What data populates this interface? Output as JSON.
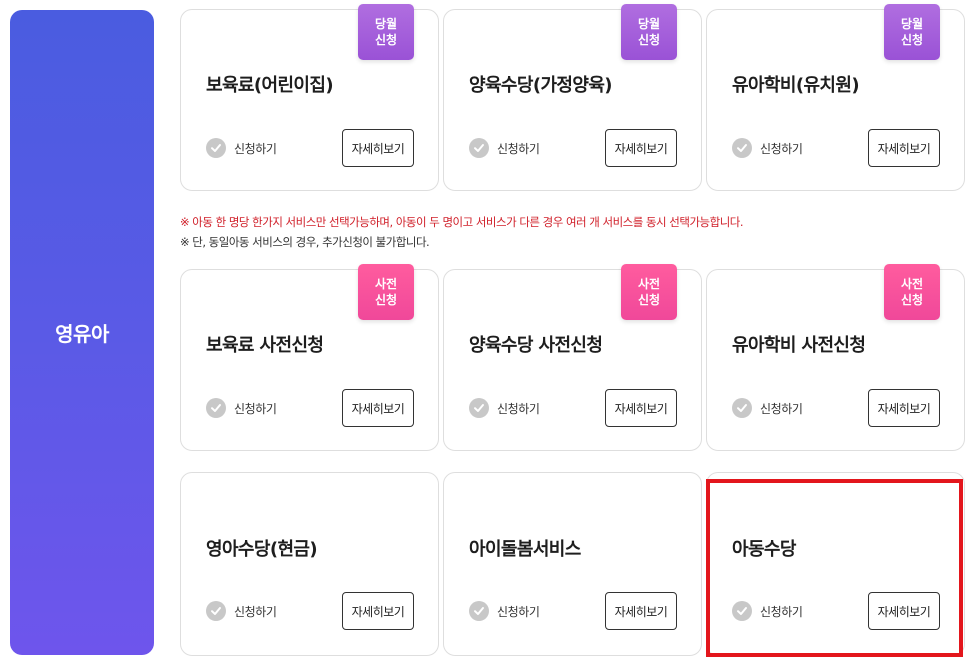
{
  "sidebar": {
    "label": "영유아"
  },
  "common": {
    "apply_label": "신청하기",
    "detail_label": "자세히보기"
  },
  "badges": {
    "monthly": {
      "line1": "당월",
      "line2": "신청"
    },
    "pre": {
      "line1": "사전",
      "line2": "신청"
    }
  },
  "row1": [
    {
      "title": "보육료(어린이집)"
    },
    {
      "title": "양육수당(가정양육)"
    },
    {
      "title": "유아학비(유치원)"
    }
  ],
  "notices": {
    "line1": "※ 아동 한 명당 한가지 서비스만 선택가능하며, 아동이 두 명이고 서비스가 다른 경우 여러 개 서비스를 동시 선택가능합니다.",
    "line2": "※ 단, 동일아동 서비스의 경우, 추가신청이 불가합니다."
  },
  "row2": [
    {
      "title": "보육료 사전신청"
    },
    {
      "title": "양육수당 사전신청"
    },
    {
      "title": "유아학비 사전신청"
    }
  ],
  "row3": [
    {
      "title": "영아수당(현금)"
    },
    {
      "title": "아이돌봄서비스"
    },
    {
      "title": "아동수당"
    }
  ],
  "colors": {
    "sidebar_gradient": [
      "#4a5ce0",
      "#6e55ec"
    ],
    "badge_monthly": "#9a52d6",
    "badge_pre": "#f0489a",
    "notice_red": "#d0202a",
    "highlight_border": "#e3161c"
  }
}
